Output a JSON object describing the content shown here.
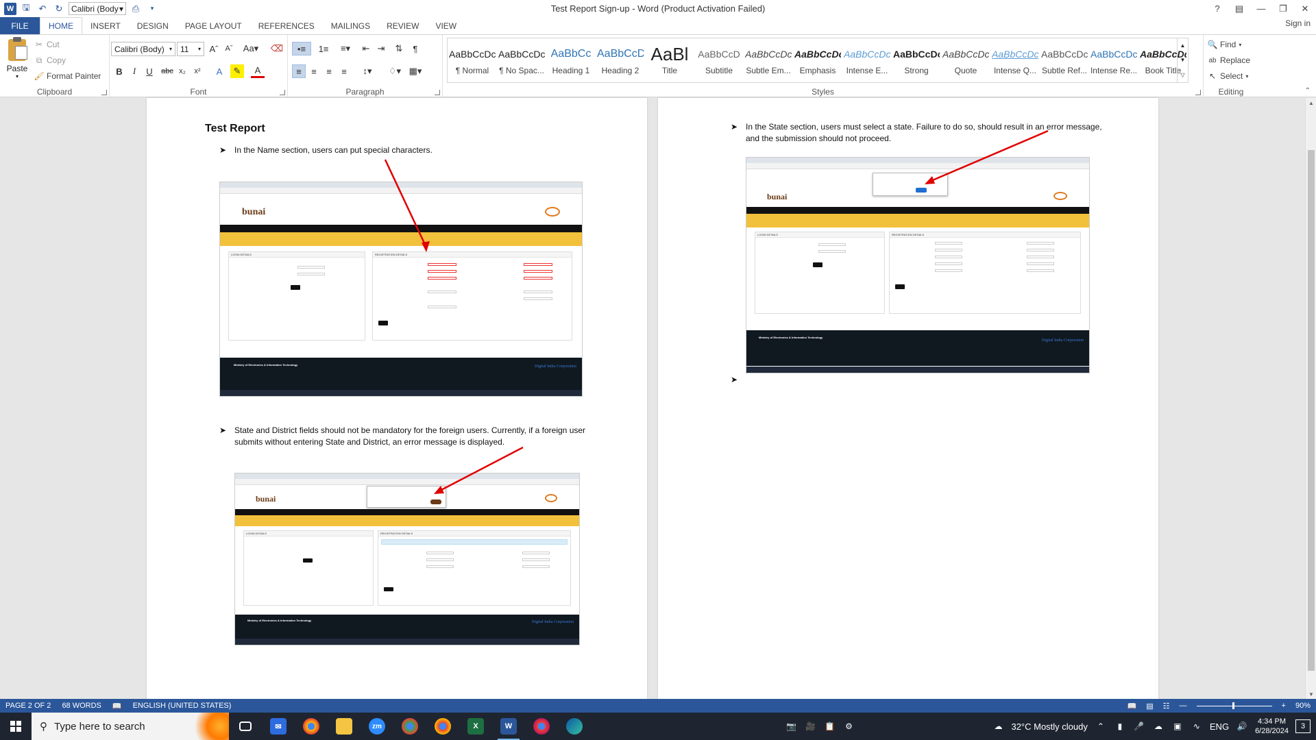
{
  "window": {
    "title": "Test Report Sign-up - Word (Product Activation Failed)",
    "qat_font": "Calibri (Body",
    "sign_in": "Sign in"
  },
  "tabs": [
    "FILE",
    "HOME",
    "INSERT",
    "DESIGN",
    "PAGE LAYOUT",
    "REFERENCES",
    "MAILINGS",
    "REVIEW",
    "VIEW"
  ],
  "active_tab": "HOME",
  "ribbon": {
    "clipboard": {
      "label": "Clipboard",
      "paste": "Paste",
      "cut": "Cut",
      "copy": "Copy",
      "format_painter": "Format Painter"
    },
    "font": {
      "label": "Font",
      "font_name": "Calibri (Body)",
      "font_size": "11"
    },
    "paragraph": {
      "label": "Paragraph"
    },
    "styles": {
      "label": "Styles",
      "items": [
        {
          "sample": "AaBbCcDc",
          "name": "¶ Normal",
          "color": "#222222"
        },
        {
          "sample": "AaBbCcDc",
          "name": "¶ No Spac...",
          "color": "#222222"
        },
        {
          "sample": "AaBbCc",
          "name": "Heading 1",
          "color": "#2e74b5"
        },
        {
          "sample": "AaBbCcD",
          "name": "Heading 2",
          "color": "#2e74b5"
        },
        {
          "sample": "AaBl",
          "name": "Title",
          "color": "#222222"
        },
        {
          "sample": "AaBbCcD",
          "name": "Subtitle",
          "color": "#666666"
        },
        {
          "sample": "AaBbCcDc",
          "name": "Subtle Em...",
          "color": "#444444"
        },
        {
          "sample": "AaBbCcDc",
          "name": "Emphasis",
          "color": "#222222"
        },
        {
          "sample": "AaBbCcDc",
          "name": "Intense E...",
          "color": "#5b9bd5"
        },
        {
          "sample": "AaBbCcDc",
          "name": "Strong",
          "color": "#222222"
        },
        {
          "sample": "AaBbCcDc",
          "name": "Quote",
          "color": "#444444"
        },
        {
          "sample": "AaBbCcDc",
          "name": "Intense Q...",
          "color": "#5b9bd5"
        },
        {
          "sample": "AaBbCcDc",
          "name": "Subtle Ref...",
          "color": "#555555"
        },
        {
          "sample": "AaBbCcDc",
          "name": "Intense Re...",
          "color": "#2e74b5"
        },
        {
          "sample": "AaBbCcDc",
          "name": "Book Title",
          "color": "#222222"
        }
      ]
    },
    "editing": {
      "label": "Editing",
      "find": "Find",
      "replace": "Replace",
      "select": "Select"
    }
  },
  "document": {
    "title": "Test Report",
    "bullets": [
      "In the Name section, users can put special characters.",
      "State and District fields should not be mandatory for the foreign users. Currently, if a foreign user submits without entering State and District, an error message is displayed.",
      "In the State section, users must select a state. Failure to do so, should result in an error message, and the submission should not proceed."
    ],
    "screenshot_text": {
      "logo": "bunai",
      "login_details": "LOGIN DETAILS",
      "registration_details": "REGISTRATION DETAILS",
      "footer_ministry": "Ministry of Electronics & Information Technology",
      "footer_corp": "Digital India Corporation"
    }
  },
  "status": {
    "page": "PAGE 2 OF 2",
    "words": "68 WORDS",
    "language": "ENGLISH (UNITED STATES)",
    "zoom": "90%"
  },
  "taskbar": {
    "search_placeholder": "Type here to search",
    "weather": "32°C  Mostly cloudy",
    "lang": "ENG",
    "time": "4:34 PM",
    "date": "6/28/2024",
    "notifications": "3"
  }
}
